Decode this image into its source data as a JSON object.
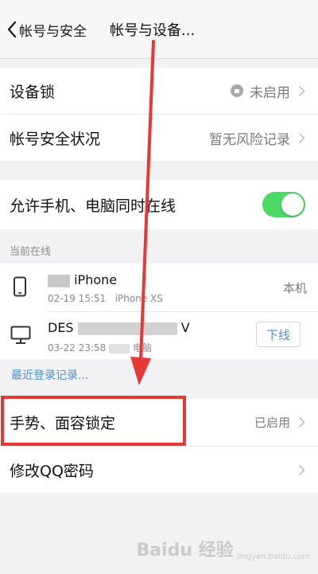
{
  "nav": {
    "back_label": "帐号与安全",
    "title": "帐号与设备..."
  },
  "group1": {
    "device_lock": {
      "label": "设备锁",
      "value": "未启用"
    },
    "account_status": {
      "label": "帐号安全状况",
      "value": "暂无风险记录"
    }
  },
  "group2": {
    "simultaneous_online": {
      "label": "允许手机、电脑同时在线",
      "enabled": true
    }
  },
  "online": {
    "section_label": "当前在线",
    "devices": [
      {
        "name_suffix": "iPhone",
        "time": "02-19 15:51",
        "model": "iPhone XS",
        "tag": "本机"
      },
      {
        "name_prefix": "DES",
        "name_suffix": "V",
        "time": "03-22 23:58",
        "model": "电脑",
        "action": "下线"
      }
    ],
    "history_link": "最近登录记录..."
  },
  "group3": {
    "gesture_face_lock": {
      "label": "手势、面容锁定",
      "value": "已启用"
    },
    "change_password": {
      "label": "修改QQ密码"
    }
  },
  "watermark": {
    "brand": "Baidu 经验",
    "sub": "jingyan.baidu.com"
  },
  "colors": {
    "toggle_on": "#4cd964",
    "link_blue": "#4b8fd6",
    "annotation_red": "#e53935"
  }
}
